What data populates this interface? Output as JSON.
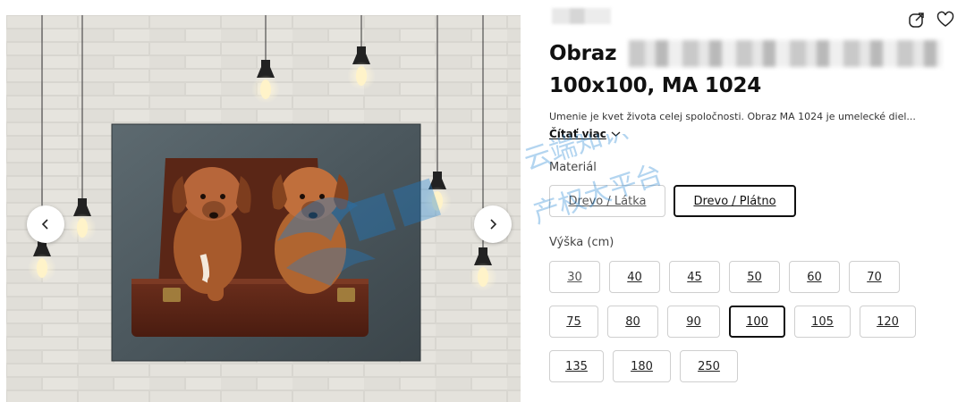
{
  "gallery": {
    "prev_icon": "chevron-left-icon",
    "next_icon": "chevron-right-icon"
  },
  "header": {
    "share_icon": "share-icon",
    "favorite_icon": "heart-icon"
  },
  "product": {
    "title_line1": "Obraz",
    "title_line2": "100x100, MA 1024",
    "description": "Umenie je kvet života celej spoločnosti. Obraz MA 1024 je umelecké diel...",
    "read_more": "Čítať viac"
  },
  "material": {
    "label": "Materiál",
    "options": [
      "Drevo / Látka",
      "Drevo / Plátno"
    ],
    "selected": "Drevo / Plátno"
  },
  "height": {
    "label": "Výška (cm)",
    "options": [
      "30",
      "40",
      "45",
      "50",
      "60",
      "70",
      "75",
      "80",
      "90",
      "100",
      "105",
      "120",
      "135",
      "180",
      "250"
    ],
    "selected": "100"
  },
  "watermark": {
    "text_top": "云端知识",
    "text_bottom": "产权大平台"
  },
  "colors": {
    "accent": "#111111",
    "border": "#cfcfcf",
    "watermark": "#1a7fd1"
  }
}
